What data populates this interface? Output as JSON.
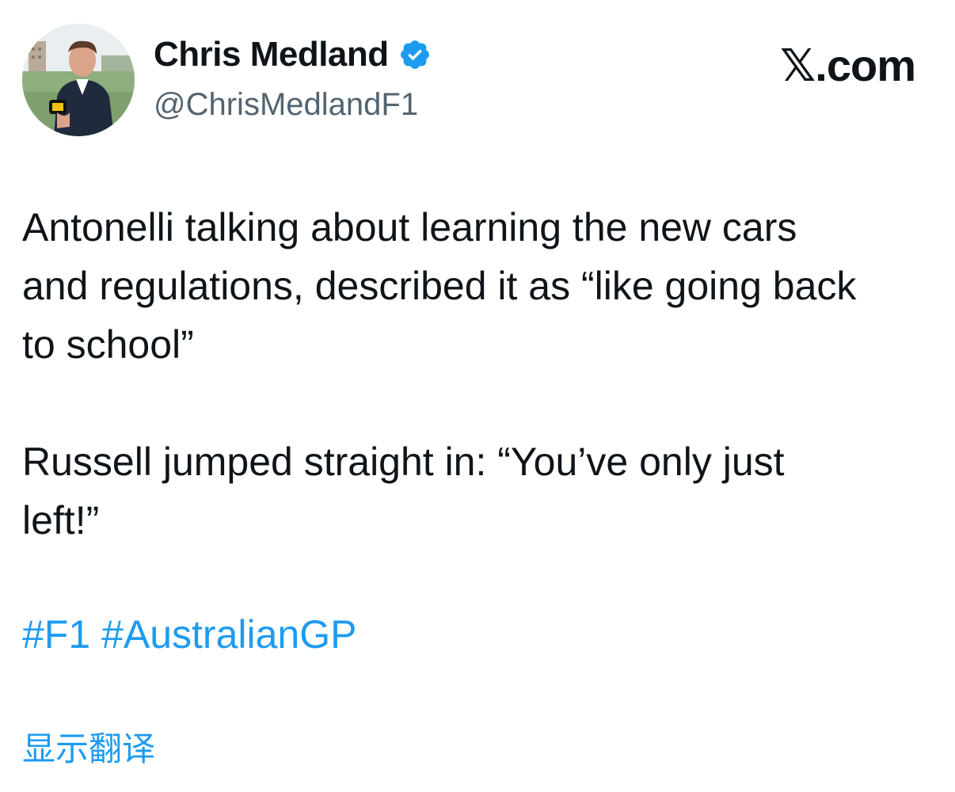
{
  "author": {
    "display_name": "Chris Medland",
    "handle": "@ChrisMedlandF1",
    "verified_icon": "verified-badge-icon",
    "avatar": "avatar-photo"
  },
  "site": {
    "label_x": "𝕏",
    "label_rest": ".com"
  },
  "tweet": {
    "lines_para1": [
      "Antonelli talking about learning the new cars",
      "and regulations, described it as “like going back",
      "to school”"
    ],
    "lines_para2": [
      "Russell jumped straight in: “You’ve only just",
      "left!”"
    ],
    "hashtags": [
      "#F1",
      "#AustralianGP"
    ]
  },
  "translate_label": "显示翻译",
  "colors": {
    "link": "#1d9bf0",
    "text": "#0f1419",
    "secondary": "#536471"
  }
}
